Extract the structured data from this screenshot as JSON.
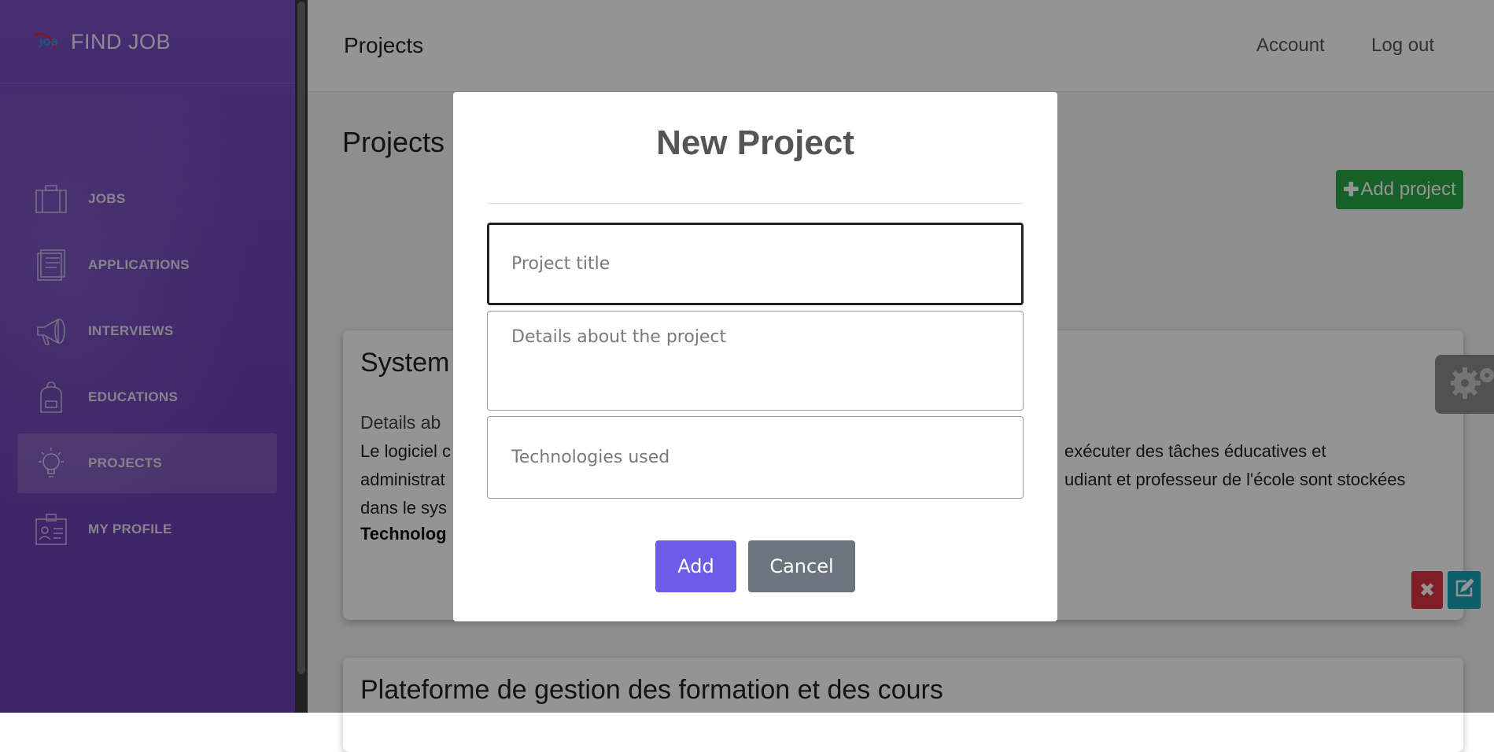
{
  "brand": {
    "name": "FIND JOB",
    "logo_text": "JOB"
  },
  "sidebar": {
    "items": [
      {
        "label": "JOBS",
        "icon": "briefcase-icon",
        "active": false
      },
      {
        "label": "APPLICATIONS",
        "icon": "document-icon",
        "active": false
      },
      {
        "label": "INTERVIEWS",
        "icon": "megaphone-icon",
        "active": false
      },
      {
        "label": "EDUCATIONS",
        "icon": "backpack-icon",
        "active": false
      },
      {
        "label": "PROJECTS",
        "icon": "lightbulb-icon",
        "active": true
      },
      {
        "label": "MY PROFILE",
        "icon": "id-badge-icon",
        "active": false
      }
    ]
  },
  "header": {
    "title": "Projects",
    "account_label": "Account",
    "logout_label": "Log out"
  },
  "page": {
    "heading": "Projects",
    "add_project_label": "Add project",
    "cards": [
      {
        "title": "System",
        "details_label": "Details ab",
        "body_line1_left": "Le logiciel c",
        "body_line1_right": "exécuter des tâches éducatives et",
        "body_line2_left": "administrat",
        "body_line2_right": "udiant et professeur de l'école sont stockées",
        "body_line3_left": "dans le sys",
        "tech_label": "Technolog"
      },
      {
        "title": "Plateforme de gestion des formation et des cours"
      }
    ]
  },
  "modal": {
    "title": "New Project",
    "fields": {
      "title_placeholder": "Project title",
      "details_placeholder": "Details about the project",
      "tech_placeholder": "Technologies used"
    },
    "add_label": "Add",
    "cancel_label": "Cancel"
  },
  "colors": {
    "sidebar": "#6e44b8",
    "add_project": "#28a745",
    "modal_add": "#6c5ce7",
    "modal_cancel": "#6c757d",
    "delete": "#dc3545",
    "edit": "#17a2b8"
  }
}
